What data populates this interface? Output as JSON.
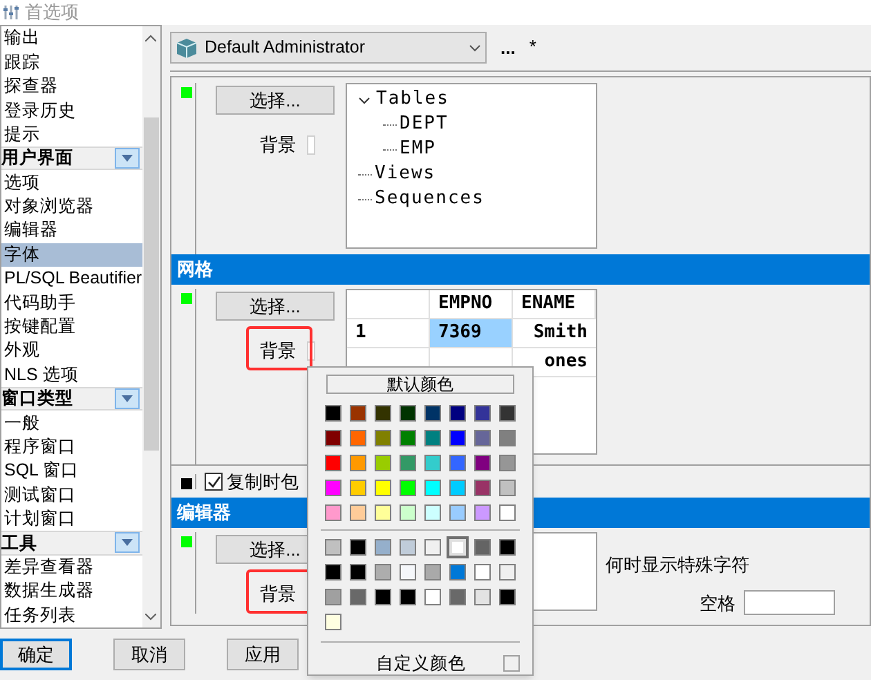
{
  "window": {
    "title": "首选项"
  },
  "sidebar": {
    "items": [
      {
        "kind": "item",
        "label": "输出",
        "selected": false
      },
      {
        "kind": "item",
        "label": "跟踪",
        "selected": false
      },
      {
        "kind": "item",
        "label": "探查器",
        "selected": false
      },
      {
        "kind": "item",
        "label": "登录历史",
        "selected": false
      },
      {
        "kind": "item",
        "label": "提示",
        "selected": false
      },
      {
        "kind": "group",
        "label": "用户界面",
        "selected": false
      },
      {
        "kind": "item",
        "label": "选项",
        "selected": false
      },
      {
        "kind": "item",
        "label": "对象浏览器",
        "selected": false
      },
      {
        "kind": "item",
        "label": "编辑器",
        "selected": false
      },
      {
        "kind": "item",
        "label": "字体",
        "selected": true
      },
      {
        "kind": "item",
        "label": "PL/SQL Beautifier",
        "selected": false
      },
      {
        "kind": "item",
        "label": "代码助手",
        "selected": false
      },
      {
        "kind": "item",
        "label": "按键配置",
        "selected": false
      },
      {
        "kind": "item",
        "label": "外观",
        "selected": false
      },
      {
        "kind": "item",
        "label": "NLS 选项",
        "selected": false
      },
      {
        "kind": "group",
        "label": "窗口类型",
        "selected": false
      },
      {
        "kind": "item",
        "label": "一般",
        "selected": false
      },
      {
        "kind": "item",
        "label": "程序窗口",
        "selected": false
      },
      {
        "kind": "item",
        "label": "SQL 窗口",
        "selected": false
      },
      {
        "kind": "item",
        "label": "测试窗口",
        "selected": false
      },
      {
        "kind": "item",
        "label": "计划窗口",
        "selected": false
      },
      {
        "kind": "group",
        "label": "工具",
        "selected": false
      },
      {
        "kind": "item",
        "label": "差异查看器",
        "selected": false
      },
      {
        "kind": "item",
        "label": "数据生成器",
        "selected": false
      },
      {
        "kind": "item",
        "label": "任务列表",
        "selected": false
      }
    ]
  },
  "toolbar": {
    "profile": "Default Administrator",
    "more": "...",
    "modified": "*"
  },
  "sections": [
    {
      "kind": "tree",
      "color": "#00ff00",
      "choose_button": "选择...",
      "background": {
        "label": "背景",
        "highlighted": false
      },
      "tree": [
        {
          "label": "Tables",
          "expanded": true,
          "children": [
            {
              "label": "DEPT"
            },
            {
              "label": "EMP"
            }
          ]
        },
        {
          "label": "Views"
        },
        {
          "label": "Sequences"
        }
      ]
    },
    {
      "kind": "grid",
      "title": "网格",
      "color": "#00ff00",
      "choose_button": "选择...",
      "background": {
        "label": "背景",
        "highlighted": true
      },
      "grid": {
        "columns": [
          "EMPNO",
          "ENAME"
        ],
        "rows": [
          {
            "number": "1",
            "empno": "7369",
            "ename": "Smith",
            "selected": true
          },
          {
            "ename": "ones",
            "selected": false
          }
        ]
      }
    },
    {
      "kind": "checkbox",
      "color": "#000000",
      "label": "复制时包",
      "checked": true
    },
    {
      "kind": "editor",
      "title": "编辑器",
      "color": "#00ff00",
      "choose_button": "选择...",
      "background": {
        "label": "背景",
        "highlighted": true
      },
      "special_chars_label": "何时显示特殊字符",
      "space_label": "空格"
    }
  ],
  "color_popup": {
    "default_button": "默认颜色",
    "palette": [
      {
        "color": "#000000"
      },
      {
        "color": "#993300"
      },
      {
        "color": "#333300"
      },
      {
        "color": "#003300"
      },
      {
        "color": "#003366"
      },
      {
        "color": "#000080"
      },
      {
        "color": "#333399"
      },
      {
        "color": "#333333"
      },
      {
        "color": "#800000"
      },
      {
        "color": "#ff6600"
      },
      {
        "color": "#808000"
      },
      {
        "color": "#008000"
      },
      {
        "color": "#008080"
      },
      {
        "color": "#0000ff"
      },
      {
        "color": "#666699"
      },
      {
        "color": "#808080"
      },
      {
        "color": "#ff0000"
      },
      {
        "color": "#ff9900"
      },
      {
        "color": "#99cc00"
      },
      {
        "color": "#339966"
      },
      {
        "color": "#33cccc"
      },
      {
        "color": "#3366ff"
      },
      {
        "color": "#800080"
      },
      {
        "color": "#969696"
      },
      {
        "color": "#ff00ff"
      },
      {
        "color": "#ffcc00"
      },
      {
        "color": "#ffff00"
      },
      {
        "color": "#00ff00"
      },
      {
        "color": "#00ffff"
      },
      {
        "color": "#00ccff"
      },
      {
        "color": "#993366"
      },
      {
        "color": "#c0c0c0"
      },
      {
        "color": "#ff99cc"
      },
      {
        "color": "#ffcc99"
      },
      {
        "color": "#ffff99"
      },
      {
        "color": "#ccffcc"
      },
      {
        "color": "#ccffff"
      },
      {
        "color": "#99ccff"
      },
      {
        "color": "#cc99ff"
      },
      {
        "color": "#ffffff"
      }
    ],
    "recent": [
      {
        "color": "#c0c0c0",
        "selected": false
      },
      {
        "color": "#000000",
        "selected": false
      },
      {
        "color": "#95afcb",
        "selected": false
      },
      {
        "color": "#c0ccd9",
        "selected": false
      },
      {
        "color": "#f0f0f0",
        "selected": false
      },
      {
        "color": "#ffffff",
        "selected": true
      },
      {
        "color": "#646464",
        "selected": false
      },
      {
        "color": "#000000",
        "selected": false
      },
      {
        "color": "#000000",
        "selected": false
      },
      {
        "color": "#000000",
        "selected": false
      },
      {
        "color": "#adadad",
        "selected": false
      },
      {
        "color": "#f5f7fa",
        "selected": false
      },
      {
        "color": "#a9a9a9",
        "selected": false
      },
      {
        "color": "#0078d7",
        "selected": false
      },
      {
        "color": "#ffffff",
        "selected": false
      },
      {
        "color": "#f0f0f0",
        "selected": false
      },
      {
        "color": "#a0a0a0",
        "selected": false
      },
      {
        "color": "#696969",
        "selected": false
      },
      {
        "color": "#000000",
        "selected": false
      },
      {
        "color": "#000000",
        "selected": false
      },
      {
        "color": "#ffffff",
        "selected": false
      },
      {
        "color": "#696969",
        "selected": false
      },
      {
        "color": "#e3e3e3",
        "selected": false
      },
      {
        "color": "#000000",
        "selected": false
      },
      {
        "color": "#ffffe1",
        "selected": false
      }
    ],
    "custom_label": "自定义颜色"
  },
  "buttons": [
    {
      "label": "确定",
      "default": true
    },
    {
      "label": "取消",
      "default": false
    },
    {
      "label": "应用",
      "default": false
    }
  ]
}
